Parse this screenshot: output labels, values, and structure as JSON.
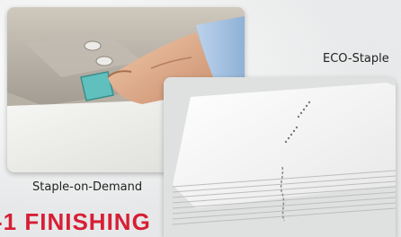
{
  "captions": {
    "left": "Staple-on-Demand",
    "right": "ECO-Staple"
  },
  "headline": "-1 FINISHING",
  "icons": [
    "staple-button-icon"
  ],
  "colors": {
    "headline": "#d61f35",
    "button": "#5fc0bd"
  }
}
